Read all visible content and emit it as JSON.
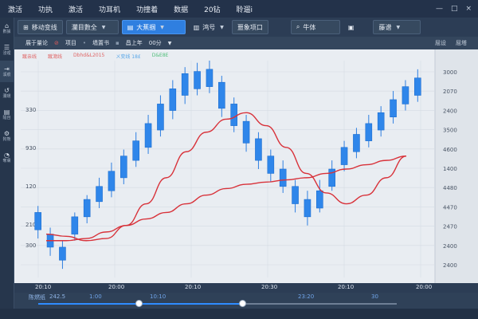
{
  "menu": {
    "items": [
      "激活",
      "功执",
      "激活",
      "功耳机",
      "功撞着",
      "数据",
      "20钻",
      "聆遛i"
    ],
    "window_controls": [
      "—",
      "□",
      "×"
    ]
  },
  "rail": {
    "items": [
      {
        "icon": "⌂",
        "label": "數據"
      },
      {
        "icon": "☰",
        "label": "浸裡"
      },
      {
        "icon": "⇥",
        "label": "溪痕"
      },
      {
        "icon": "↺",
        "label": "瀾環"
      },
      {
        "icon": "▤",
        "label": "隨自"
      },
      {
        "icon": "⚙",
        "label": "狗熊"
      },
      {
        "icon": "◔",
        "label": "奪膚"
      }
    ]
  },
  "toolbar": {
    "move_label": "移动变线",
    "project_select": "瀾目數全",
    "candle_select": "大蕉掴",
    "period_label": "鸿号",
    "indicator_label": "噩象项口",
    "search_label": "牛体",
    "right_select": "藤谱"
  },
  "subbar": {
    "items": [
      "展于量论",
      "项目",
      "墙置书",
      "昌上年",
      "00分"
    ],
    "right": [
      "屈设",
      "屈塔"
    ]
  },
  "legend": [
    {
      "label": "蹴亲线",
      "color": "#e06565"
    },
    {
      "label": "蹴瀉线",
      "color": "#e06565"
    },
    {
      "label": "Dbhd&L2015",
      "color": "#e06565"
    },
    {
      "label": "ㄨ变线 18£",
      "color": "#58a6e8"
    },
    {
      "label": "D&E8E",
      "color": "#4fbf7a"
    }
  ],
  "chart_data": {
    "type": "candlestick",
    "y_left_ticks": [
      "330",
      "930",
      "120",
      "210",
      "300"
    ],
    "y_right_ticks": [
      "3000",
      "2070",
      "2400",
      "3500",
      "4600",
      "1400",
      "4480",
      "4470",
      "2470",
      "2400",
      "2400"
    ],
    "x_ticks": [
      "20:10",
      "20:00",
      "20:10",
      "20:30",
      "20:10",
      "20:00"
    ],
    "candles": [
      {
        "open": 30,
        "close": 22,
        "high": 33,
        "low": 18
      },
      {
        "open": 20,
        "close": 14,
        "high": 23,
        "low": 10
      },
      {
        "open": 14,
        "close": 8,
        "high": 17,
        "low": 4
      },
      {
        "open": 20,
        "close": 28,
        "high": 30,
        "low": 17
      },
      {
        "open": 28,
        "close": 36,
        "high": 38,
        "low": 25
      },
      {
        "open": 35,
        "close": 42,
        "high": 46,
        "low": 32
      },
      {
        "open": 40,
        "close": 49,
        "high": 53,
        "low": 37
      },
      {
        "open": 46,
        "close": 56,
        "high": 59,
        "low": 43
      },
      {
        "open": 54,
        "close": 63,
        "high": 67,
        "low": 51
      },
      {
        "open": 60,
        "close": 71,
        "high": 75,
        "low": 57
      },
      {
        "open": 68,
        "close": 80,
        "high": 84,
        "low": 65
      },
      {
        "open": 77,
        "close": 87,
        "high": 91,
        "low": 73
      },
      {
        "open": 84,
        "close": 94,
        "high": 97,
        "low": 80
      },
      {
        "open": 87,
        "close": 95,
        "high": 99,
        "low": 84
      },
      {
        "open": 96,
        "close": 88,
        "high": 100,
        "low": 85
      },
      {
        "open": 90,
        "close": 78,
        "high": 93,
        "low": 74
      },
      {
        "open": 80,
        "close": 70,
        "high": 83,
        "low": 67
      },
      {
        "open": 72,
        "close": 62,
        "high": 75,
        "low": 58
      },
      {
        "open": 64,
        "close": 54,
        "high": 67,
        "low": 50
      },
      {
        "open": 56,
        "close": 48,
        "high": 59,
        "low": 44
      },
      {
        "open": 50,
        "close": 42,
        "high": 54,
        "low": 39
      },
      {
        "open": 42,
        "close": 34,
        "high": 45,
        "low": 30
      },
      {
        "open": 36,
        "close": 28,
        "high": 40,
        "low": 24
      },
      {
        "open": 32,
        "close": 40,
        "high": 45,
        "low": 30
      },
      {
        "open": 42,
        "close": 50,
        "high": 54,
        "low": 40
      },
      {
        "open": 52,
        "close": 60,
        "high": 63,
        "low": 49
      },
      {
        "open": 58,
        "close": 66,
        "high": 69,
        "low": 55
      },
      {
        "open": 63,
        "close": 71,
        "high": 75,
        "low": 60
      },
      {
        "open": 68,
        "close": 76,
        "high": 79,
        "low": 65
      },
      {
        "open": 74,
        "close": 82,
        "high": 86,
        "low": 71
      },
      {
        "open": 80,
        "close": 88,
        "high": 91,
        "low": 77
      },
      {
        "open": 84,
        "close": 92,
        "high": 96,
        "low": 81
      }
    ],
    "series": [
      {
        "values": [
          20,
          19,
          17,
          18,
          24,
          34,
          46,
          58,
          67,
          73,
          76,
          70,
          60,
          48,
          39,
          34,
          38,
          46,
          56
        ]
      },
      {
        "values": [
          17,
          17,
          18,
          21,
          24,
          27,
          30,
          34,
          38,
          41,
          43,
          44,
          45,
          46,
          48,
          50,
          52,
          54,
          56
        ]
      }
    ],
    "ylim": [
      0,
      100
    ]
  },
  "timeaxis": [
    "20:10",
    "20:00",
    "20:10",
    "20:30",
    "20:10",
    "20:00"
  ],
  "slider": {
    "label": "陈燃纸",
    "value": "242.5",
    "ticks": [
      "1:00",
      "10:10",
      "23:20",
      "30"
    ],
    "range": [
      0.28,
      0.57
    ]
  }
}
